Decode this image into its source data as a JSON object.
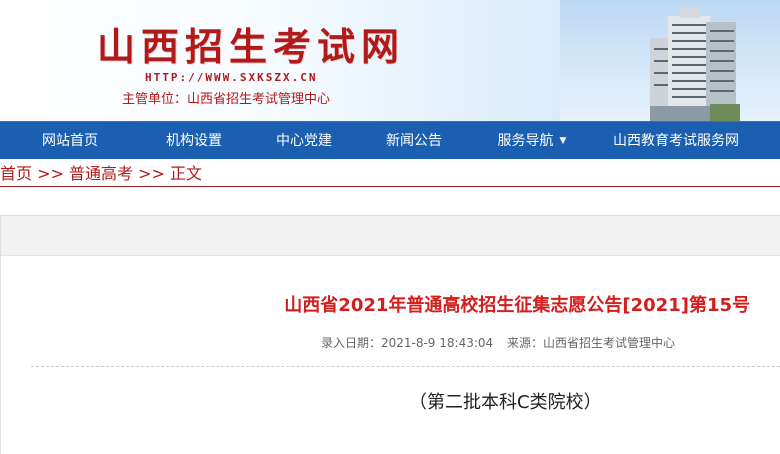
{
  "header": {
    "title": "山西招生考试网",
    "url": "HTTP://WWW.SXKSZX.CN",
    "sponsor": "主管单位：山西省招生考试管理中心"
  },
  "nav": {
    "items": [
      {
        "label": "网站首页"
      },
      {
        "label": "机构设置"
      },
      {
        "label": "中心党建"
      },
      {
        "label": "新闻公告"
      },
      {
        "label": "服务导航"
      },
      {
        "label": "山西教育考试服务网"
      }
    ]
  },
  "breadcrumb": {
    "home": "首页",
    "sep1": " >> ",
    "section": "普通高考",
    "sep2": " >> ",
    "current": "正文"
  },
  "article": {
    "title": "山西省2021年普通高校招生征集志愿公告[2021]第15号",
    "date": "录入日期：2021-8-9 18:43:04",
    "source": "来源：山西省招生考试管理中心",
    "first_line": "（第二批本科C类院校）"
  },
  "colors": {
    "brand_red": "#b11a1a",
    "nav_blue": "#1a5fb0",
    "title_red": "#d41e1e"
  }
}
